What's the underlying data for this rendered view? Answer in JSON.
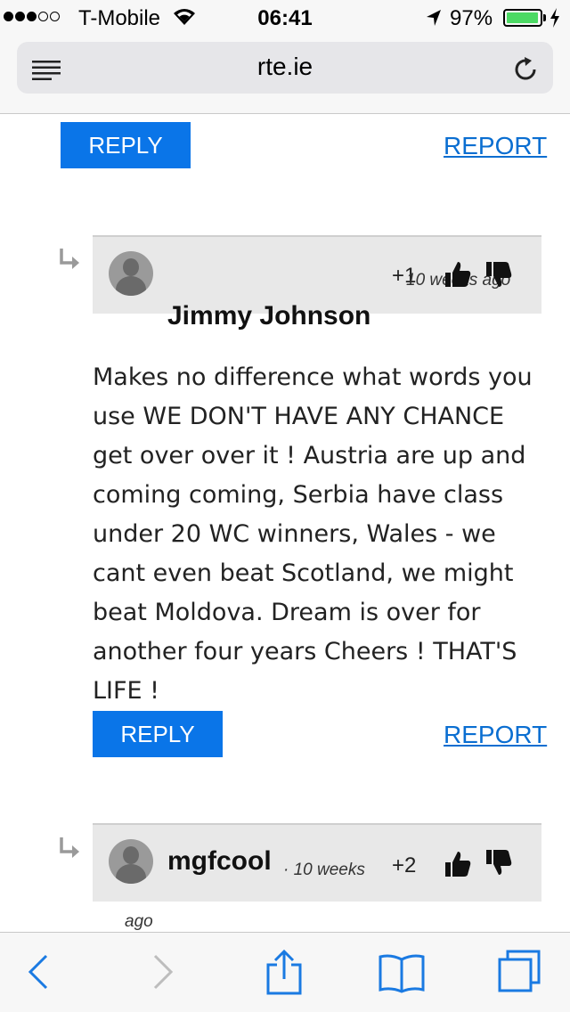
{
  "status_bar": {
    "carrier": "T-Mobile",
    "time": "06:41",
    "battery_percent": "97%",
    "battery_level": 0.97,
    "signal_bars": 3,
    "signal_total": 5
  },
  "browser": {
    "url": "rte.ie",
    "icons": [
      "reader-icon",
      "reload-icon"
    ]
  },
  "top_actions": {
    "reply_label": "REPLY",
    "report_label": "REPORT"
  },
  "comments": [
    {
      "author": "Jimmy Johnson",
      "votes": "+1",
      "time": "10 weeks ago",
      "body": "Makes no difference what words you use WE DON'T HAVE ANY CHANCE get over over it ! Austria are up and coming coming, Serbia have class under 20 WC winners, Wales - we cant even beat Scotland, we might beat Moldova. Dream is over for another four years Cheers ! THAT'S LIFE !",
      "reply_label": "REPLY",
      "report_label": "REPORT"
    },
    {
      "author": "mgfcool",
      "votes": "+2",
      "time_line1": "· 10 weeks",
      "time_line2": "ago"
    }
  ],
  "toolbar": {
    "icons": [
      "back-icon",
      "forward-icon",
      "share-icon",
      "bookmarks-icon",
      "tabs-icon"
    ]
  },
  "colors": {
    "accent": "#0a75e8",
    "link": "#0a6ed1",
    "battery": "#4cd964"
  }
}
